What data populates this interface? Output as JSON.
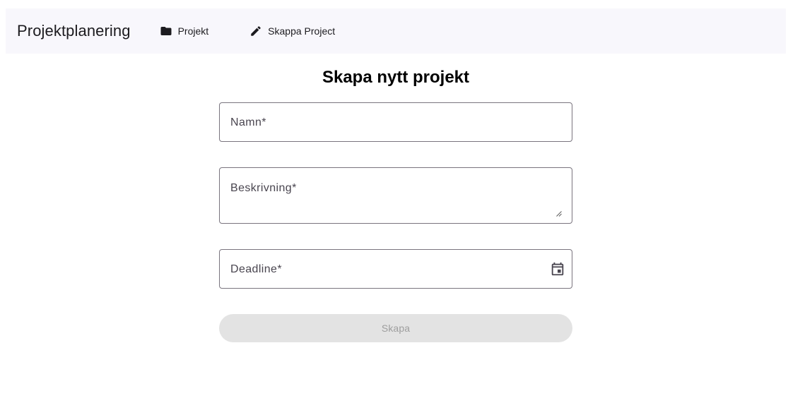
{
  "header": {
    "brand": "Projektplanering",
    "nav": {
      "projekt_label": "Projekt",
      "projekt_icon": "folder-icon",
      "skapa_label": "Skappa Project",
      "skapa_icon": "pencil-icon"
    },
    "background": "#f8f7fc"
  },
  "form": {
    "title": "Skapa nytt projekt",
    "name_field": {
      "label": "Namn*",
      "value": ""
    },
    "description_field": {
      "label": "Beskrivning*",
      "value": ""
    },
    "deadline_field": {
      "label": "Deadline*",
      "value": "",
      "icon": "calendar-icon"
    },
    "submit_label": "Skapa",
    "submit_disabled": true
  }
}
